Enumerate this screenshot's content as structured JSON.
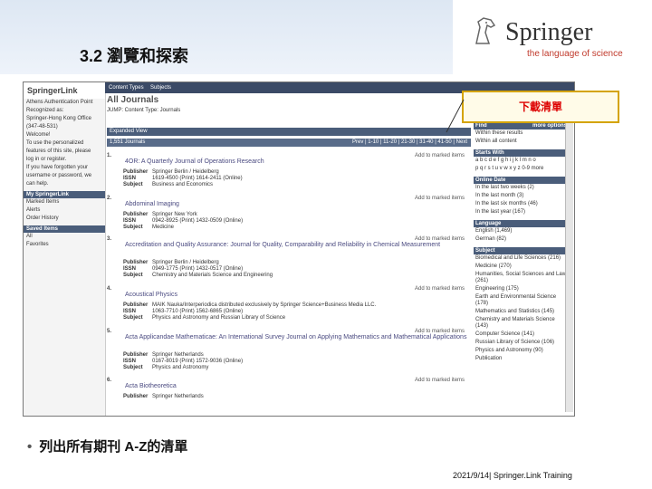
{
  "slide_title": "3.2 瀏覽和探索",
  "logo": {
    "name": "Springer",
    "tagline": "the language of science"
  },
  "callout": "下載清單",
  "bullet": "列出所有期刊 A-Z的清單",
  "footer": "2021/9/14| Springer.Link Training",
  "shot": {
    "brand": "SpringerLink",
    "topnav": [
      "Content Types",
      "Subjects"
    ],
    "page_title": "All Journals",
    "breadcrumb": "JUMP: Content Type: Journals",
    "expanded_view": "Expanded View",
    "count": "1,551 Journals",
    "pager": "Prev | 1-10 | 11-20 | 21-30 | 31-40 | 41-50 | Next",
    "sidebar": [
      "Athens Authentication Point",
      "Recognized as:",
      "Springer-Hong Kong Office",
      "(347-48-531)",
      "Welcome!",
      "To use the personalized",
      "features of this site, please",
      "log in or register.",
      "If you have forgotten your",
      "username or password, we",
      "can help."
    ],
    "sidebar_sections": [
      {
        "head": "My SpringerLink",
        "items": [
          "Marked Items",
          "Alerts",
          "Order History"
        ]
      },
      {
        "head": "Saved Items",
        "items": [
          "All",
          "Favorites"
        ]
      }
    ],
    "entries": [
      {
        "num": "1.",
        "title": "4OR: A Quarterly Journal of Operations Research",
        "publisher": "Springer Berlin / Heidelberg",
        "issn": "1619-4500 (Print) 1614-2411 (Online)",
        "subject": "Business and Economics"
      },
      {
        "num": "2.",
        "title": "Abdominal Imaging",
        "publisher": "Springer New York",
        "issn": "0942-8925 (Print) 1432-0509 (Online)",
        "subject": "Medicine"
      },
      {
        "num": "3.",
        "title": "Accreditation and Quality Assurance: Journal for Quality, Comparability and Reliability in Chemical Measurement",
        "publisher": "Springer Berlin / Heidelberg",
        "issn": "0949-1775 (Print) 1432-0517 (Online)",
        "subject": "Chemistry and Materials Science and Engineering"
      },
      {
        "num": "4.",
        "title": "Acoustical Physics",
        "publisher": "MAIK Nauka/Interperiodica distributed exclusively by Springer Science+Business Media LLC.",
        "issn": "1063-7710 (Print) 1562-6865 (Online)",
        "subject": "Physics and Astronomy and Russian Library of Science"
      },
      {
        "num": "5.",
        "title": "Acta Applicandae Mathematicae: An International Survey Journal on Applying Mathematics and Mathematical Applications",
        "publisher": "Springer Netherlands",
        "issn": "0167-8019 (Print) 1572-9036 (Online)",
        "subject": "Physics and Astronomy"
      },
      {
        "num": "6.",
        "title": "Acta Biotheoretica",
        "publisher": "Springer Netherlands",
        "issn": "",
        "subject": ""
      }
    ],
    "add_label": "Add to marked items",
    "right_panel": {
      "find": "Find",
      "more_options": "more options",
      "within_results": "Within these results",
      "within_all": "Within all content",
      "starts_with": "Starts With",
      "alphabet_1": "a b c d e f g h i j k l m n o",
      "alphabet_2": "p q r s t u v w x y z 0-9 more",
      "online_date": "Online Date",
      "dates": [
        "In the last two weeks (2)",
        "In the last month (3)",
        "In the last six months (46)",
        "In the last year (167)"
      ],
      "language": "Language",
      "languages": [
        "English (1,469)",
        "German (82)"
      ],
      "subject": "Subject",
      "subjects": [
        "Biomedical and Life Sciences (216)",
        "Medicine (270)",
        "Humanities, Social Sciences and Law (261)",
        "Engineering (175)",
        "Earth and Environmental Science (178)",
        "Mathematics and Statistics (145)",
        "Chemistry and Materials Science (143)",
        "Computer Science (141)",
        "Russian Library of Science (106)",
        "Physics and Astronomy (90)",
        "Publication"
      ]
    }
  }
}
